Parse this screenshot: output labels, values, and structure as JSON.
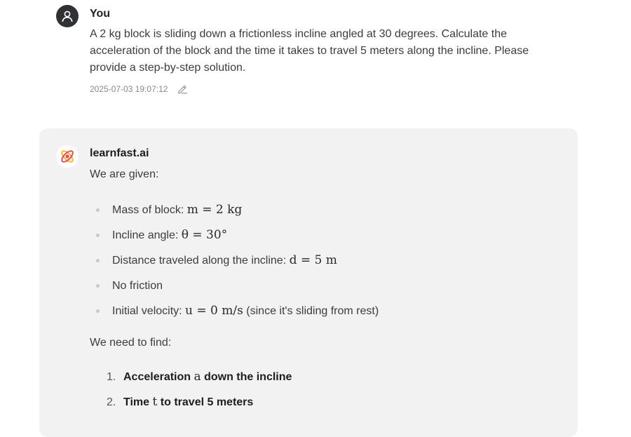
{
  "user_message": {
    "author": "You",
    "text": "A 2 kg block is sliding down a frictionless incline angled at 30 degrees. Calculate the acceleration of the block and the time it takes to travel 5 meters along the incline. Please provide a step-by-step solution.",
    "timestamp": "2025-07-03 19:07:12",
    "icons": {
      "avatar": "user-icon",
      "edit": "pencil-icon"
    }
  },
  "ai_message": {
    "author": "learnfast.ai",
    "intro": "We are given:",
    "givens": [
      {
        "label": "Mass of block: ",
        "math": "m = 2 kg",
        "suffix": ""
      },
      {
        "label": "Incline angle: ",
        "math": "θ = 30°",
        "suffix": ""
      },
      {
        "label": "Distance traveled along the incline: ",
        "math": "d = 5 m",
        "suffix": ""
      },
      {
        "label": "No friction",
        "math": "",
        "suffix": ""
      },
      {
        "label": "Initial velocity: ",
        "math": "u = 0 m/s",
        "suffix": " (since it's sliding from rest)"
      }
    ],
    "need_intro": "We need to find:",
    "goals": [
      {
        "number": "1.",
        "before": "Acceleration ",
        "math": "a",
        "after": " down the incline"
      },
      {
        "number": "2.",
        "before": "Time ",
        "math": "t",
        "after": " to travel 5 meters"
      }
    ],
    "icons": {
      "logo": "learnfast-logo-icon"
    },
    "colors": {
      "card_background": "#f2f2f2",
      "logo_red": "#e94e4e",
      "logo_yellow": "#f5b82e"
    }
  }
}
